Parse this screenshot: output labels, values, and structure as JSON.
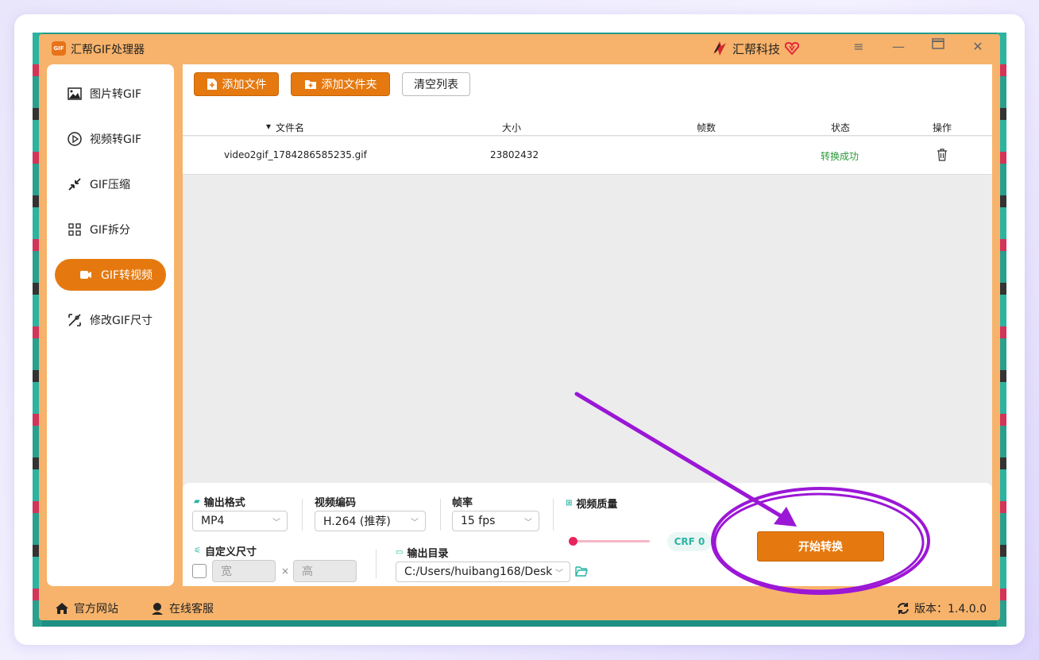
{
  "app": {
    "title": "汇帮GIF处理器",
    "logo_text": "GIF",
    "brand": "汇帮科技",
    "accent_color": "#e5790f",
    "window_controls": [
      "menu-icon",
      "minimize-icon",
      "maximize-icon",
      "close-icon"
    ]
  },
  "sidebar": {
    "items": [
      {
        "label": "图片转GIF",
        "icon": "image-icon"
      },
      {
        "label": "视频转GIF",
        "icon": "play-icon"
      },
      {
        "label": "GIF压缩",
        "icon": "compress-icon"
      },
      {
        "label": "GIF拆分",
        "icon": "split-icon"
      },
      {
        "label": "GIF转视频",
        "icon": "video-icon",
        "active": true
      },
      {
        "label": "修改GIF尺寸",
        "icon": "resize-icon"
      }
    ]
  },
  "toolbar": {
    "add_file": "添加文件",
    "add_folder": "添加文件夹",
    "clear_list": "清空列表"
  },
  "table": {
    "columns": [
      "文件名",
      "大小",
      "帧数",
      "状态",
      "操作"
    ],
    "rows": [
      {
        "filename": "video2gif_1784286585235.gif",
        "size": "23802432",
        "frames": "",
        "status": "转换成功",
        "action": "delete-icon"
      }
    ]
  },
  "options": {
    "output_format_label": "输出格式",
    "output_format_value": "MP4",
    "codec_label": "视频编码",
    "codec_value": "H.264 (推荐)",
    "fps_label": "帧率",
    "fps_value": "15 fps",
    "quality_label": "视频质量",
    "quality_badge": "CRF 0",
    "quality_level": 0,
    "custom_size_label": "自定义尺寸",
    "width_placeholder": "宽",
    "height_placeholder": "高",
    "times": "×",
    "output_dir_label": "输出目录",
    "output_dir_value": "C:/Users/huibang168/Desk",
    "start_button": "开始转换"
  },
  "footer": {
    "website": "官方网站",
    "support": "在线客服",
    "version": "版本：1.4.0.0"
  }
}
